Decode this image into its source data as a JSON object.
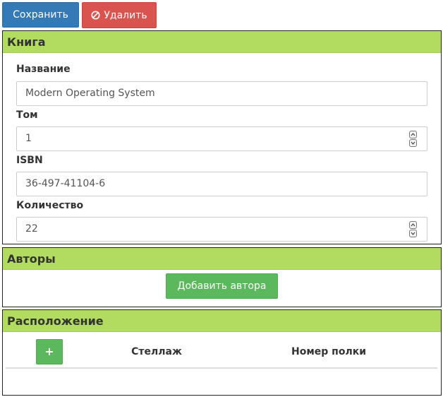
{
  "toolbar": {
    "save_label": "Сохранить",
    "delete_label": "Удалить",
    "delete_icon": "ban-icon"
  },
  "book": {
    "title": "Книга",
    "fields": [
      {
        "label": "Название",
        "value": "Modern Operating System",
        "type": "text"
      },
      {
        "label": "Том",
        "value": "1",
        "type": "number"
      },
      {
        "label": "ISBN",
        "value": "36-497-41104-6",
        "type": "text"
      },
      {
        "label": "Количество",
        "value": "22",
        "type": "number"
      }
    ]
  },
  "authors": {
    "title": "Авторы",
    "add_label": "Добавить автора"
  },
  "location": {
    "title": "Расположение",
    "add_symbol": "+",
    "columns": [
      "Стеллаж",
      "Номер полки"
    ]
  },
  "colors": {
    "panel_header": "#b1dc5f",
    "primary": "#337ab7",
    "danger": "#d9534f",
    "success": "#5cb85c"
  }
}
